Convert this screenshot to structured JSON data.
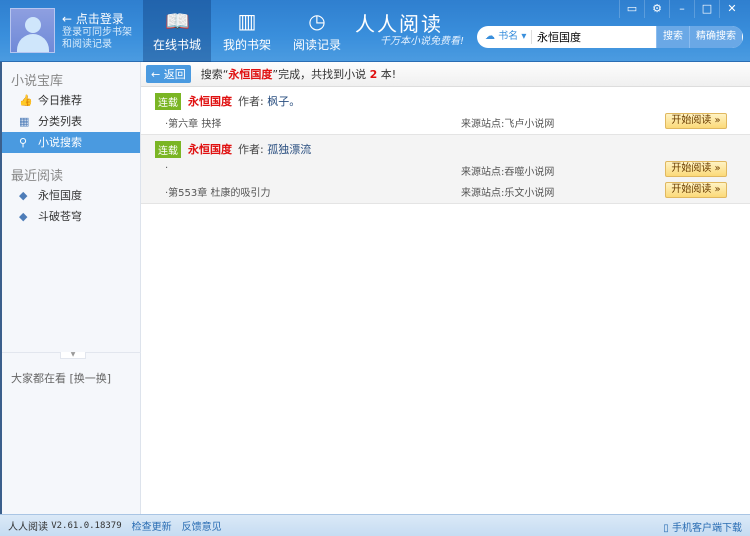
{
  "header": {
    "login_title": "点击登录",
    "login_sub": [
      "登录可同步书架",
      "和阅读记录"
    ],
    "tabs": [
      {
        "label": "在线书城",
        "icon": "open-book-icon"
      },
      {
        "label": "我的书架",
        "icon": "bookshelf-icon"
      },
      {
        "label": "阅读记录",
        "icon": "clock-icon"
      }
    ],
    "brand": "人人阅读",
    "slogan": "千万本小说免费看!",
    "search": {
      "category": "书名",
      "value": "永恒国度",
      "search_btn": "搜索",
      "exact_btn": "精确搜索"
    }
  },
  "sidebar": {
    "section1": "小说宝库",
    "items": [
      {
        "label": "今日推荐",
        "icon": "thumbs-up-icon"
      },
      {
        "label": "分类列表",
        "icon": "grid-icon"
      },
      {
        "label": "小说搜索",
        "icon": "search-icon"
      }
    ],
    "section2": "最近阅读",
    "recent": [
      "永恒国度",
      "斗破苍穹"
    ],
    "hot": "大家都在看",
    "refresh": "[换一换]"
  },
  "toolbar": {
    "back": "返回",
    "msg_prefix": "搜索“",
    "keyword": "永恒国度",
    "msg_mid": "”完成，共找到小说",
    "count": "2",
    "msg_suffix": "本!"
  },
  "results": [
    {
      "status": "连载",
      "title": "永恒国度",
      "author_label": "作者:",
      "author": "枫子。",
      "rows": [
        {
          "chapter": "·第六章 抉择",
          "source": "来源站点:飞卢小说网",
          "read": "开始阅读 »"
        }
      ]
    },
    {
      "status": "连载",
      "title": "永恒国度",
      "author_label": "作者:",
      "author": "孤独漂流",
      "rows": [
        {
          "chapter": "·",
          "source": "来源站点:吞噬小说网",
          "read": "开始阅读 »"
        },
        {
          "chapter": "·第553章 杜康的吸引力",
          "source": "来源站点:乐文小说网",
          "read": "开始阅读 »"
        }
      ]
    }
  ],
  "footer": {
    "app": "人人阅读",
    "version": "V2.61.0.18379",
    "check_update": "检查更新",
    "feedback": "反馈意见",
    "mobile": "手机客户端下载"
  }
}
